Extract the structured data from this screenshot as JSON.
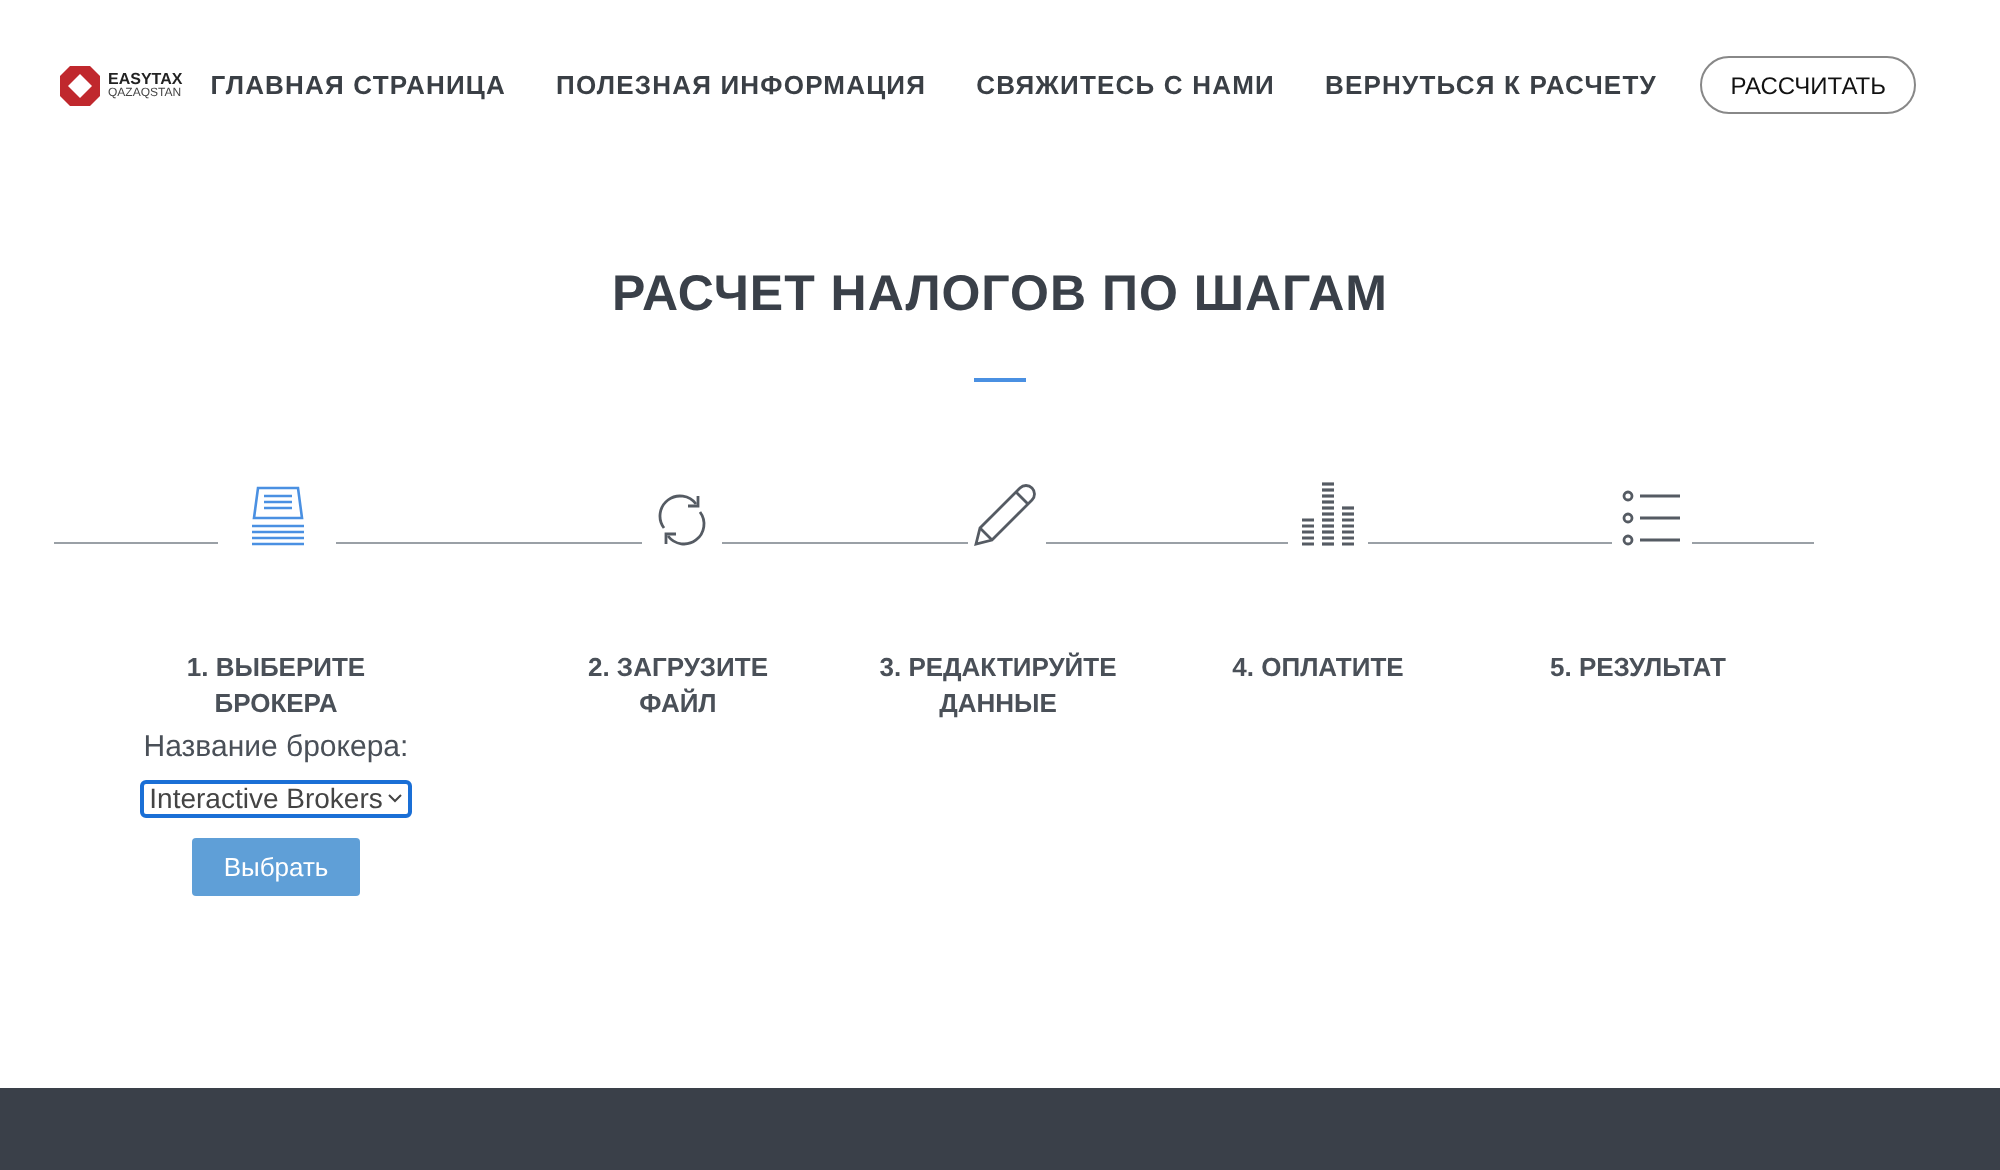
{
  "logo": {
    "name": "EASYTAX",
    "sub": "QAZAQSTAN"
  },
  "nav": [
    {
      "label": "ГЛАВНАЯ СТРАНИЦА"
    },
    {
      "label": "ПОЛЕЗНАЯ ИНФОРМАЦИЯ"
    },
    {
      "label": "СВЯЖИТЕСЬ С НАМИ"
    },
    {
      "label": "ВЕРНУТЬСЯ К РАСЧЕТУ"
    }
  ],
  "nav_button": "РАССЧИТАТЬ",
  "title": "РАСЧЕТ НАЛОГОВ ПО ШАГАМ",
  "steps": [
    {
      "label": "1. ВЫБЕРИТЕ БРОКЕРА",
      "selected": true
    },
    {
      "label": "2. ЗАГРУЗИТЕ ФАЙЛ",
      "selected": false
    },
    {
      "label": "3. РЕДАКТИРУЙТЕ ДАННЫЕ",
      "selected": false
    },
    {
      "label": "4. ОПЛАТИТЕ",
      "selected": false
    },
    {
      "label": "5. РЕЗУЛЬТАТ",
      "selected": false
    }
  ],
  "broker_form": {
    "label": "Название брокера:",
    "value": "Interactive Brokers",
    "button": "Выбрать"
  }
}
